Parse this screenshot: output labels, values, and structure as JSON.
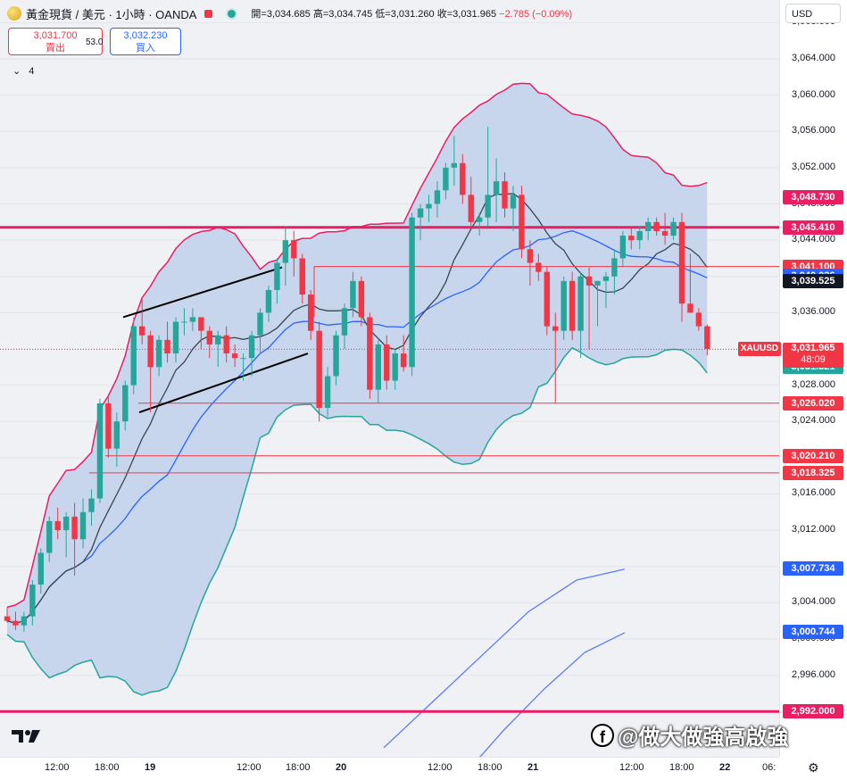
{
  "header": {
    "symbol": "黃金現貨 / 美元 · 1小時 · OANDA",
    "open_label": "開=3,034.685",
    "high_label": "高=3,034.745",
    "low_label": "低=3,031.260",
    "close_label": "收=3,031.965",
    "change": "−2.785 (−0.09%)"
  },
  "trade": {
    "sell_price": "3,031.700",
    "sell_label": "賣出",
    "spread": "53.0",
    "buy_price": "3,032.230",
    "buy_label": "買入"
  },
  "indicators_count": "4",
  "currency": "USD",
  "colors": {
    "up": "#26a69a",
    "down": "#f23645",
    "level": "#e91e63",
    "band_fill": "#c3d3ec",
    "band_upper": "#e91e63",
    "band_lower": "#26a69a",
    "ma_blue": "#2962ff",
    "ma_dark": "#37474f"
  },
  "price_axis": {
    "ticks": [
      "3,068.000",
      "3,064.000",
      "3,060.000",
      "3,056.000",
      "3,052.000",
      "3,048.000",
      "3,044.000",
      "3,040.000",
      "3,036.000",
      "3,032.000",
      "3,028.000",
      "3,024.000",
      "3,020.000",
      "3,016.000",
      "3,012.000",
      "3,008.000",
      "3,004.000",
      "3,000.000",
      "2,996.000",
      "2,992.000"
    ],
    "labels": [
      {
        "text": "3,048.730",
        "color": "#e91e63",
        "price": 3048.73
      },
      {
        "text": "3,045.410",
        "color": "#e91e63",
        "price": 3045.41
      },
      {
        "text": "3,041.100",
        "color": "#f23645",
        "price": 3041.1
      },
      {
        "text": "3,040.026",
        "color": "#2962ff",
        "price": 3040.026
      },
      {
        "text": "3,039.525",
        "color": "#131722",
        "price": 3039.525
      },
      {
        "text": "3,031.321",
        "color": "#26a69a",
        "price": 3030.0
      },
      {
        "text": "3,026.020",
        "color": "#f23645",
        "price": 3026.02
      },
      {
        "text": "3,020.210",
        "color": "#f23645",
        "price": 3020.21
      },
      {
        "text": "3,018.325",
        "color": "#f23645",
        "price": 3018.325
      },
      {
        "text": "3,007.734",
        "color": "#2962ff",
        "price": 3007.734
      },
      {
        "text": "3,000.744",
        "color": "#2962ff",
        "price": 3000.744
      },
      {
        "text": "2,992.000",
        "color": "#e91e63",
        "price": 2992.0
      }
    ],
    "current": {
      "symbol": "XAUUSD",
      "price_text": "3,031.965",
      "countdown": "48:09",
      "price": 3031.965
    }
  },
  "time_axis": [
    "12:00",
    "18:00",
    "19",
    "12:00",
    "18:00",
    "20",
    "12:00",
    "18:00",
    "21",
    "12:00",
    "18:00",
    "22",
    "06:"
  ],
  "watermark": "@做大做強高啟強",
  "chart_data": {
    "type": "candlestick",
    "ylim": [
      2987,
      3070.5
    ],
    "candles": [
      [
        3002.5,
        3003.5,
        3001.8,
        3002.0
      ],
      [
        3002.0,
        3003.0,
        3001.0,
        3001.5
      ],
      [
        3001.5,
        3003.0,
        3000.8,
        3002.5
      ],
      [
        3002.5,
        3006.5,
        3001.5,
        3006.0
      ],
      [
        3006.0,
        3010.0,
        3005.0,
        3009.5
      ],
      [
        3009.5,
        3013.5,
        3008.5,
        3013.0
      ],
      [
        3013.0,
        3014.5,
        3011.0,
        3012.0
      ],
      [
        3012.0,
        3014.0,
        3009.0,
        3013.5
      ],
      [
        3013.5,
        3015.0,
        3007.0,
        3011.0
      ],
      [
        3011.0,
        3015.5,
        3010.0,
        3014.0
      ],
      [
        3014.0,
        3016.5,
        3012.5,
        3015.5
      ],
      [
        3015.5,
        3026.5,
        3015.0,
        3026.0
      ],
      [
        3026.0,
        3027.0,
        3020.0,
        3021.0
      ],
      [
        3021.0,
        3025.0,
        3019.0,
        3024.0
      ],
      [
        3024.0,
        3028.5,
        3023.0,
        3028.0
      ],
      [
        3028.0,
        3035.5,
        3027.0,
        3034.5
      ],
      [
        3034.5,
        3037.5,
        3032.5,
        3033.5
      ],
      [
        3033.5,
        3034.0,
        3025.0,
        3030.0
      ],
      [
        3030.0,
        3033.5,
        3029.0,
        3033.0
      ],
      [
        3033.0,
        3035.0,
        3030.5,
        3031.5
      ],
      [
        3031.5,
        3035.5,
        3030.5,
        3035.0
      ],
      [
        3035.0,
        3036.5,
        3033.5,
        3035.0
      ],
      [
        3035.0,
        3036.5,
        3034.0,
        3035.5
      ],
      [
        3035.5,
        3035.5,
        3032.0,
        3034.0
      ],
      [
        3034.0,
        3034.5,
        3031.0,
        3032.5
      ],
      [
        3032.5,
        3034.0,
        3030.0,
        3033.5
      ],
      [
        3033.5,
        3034.5,
        3030.5,
        3031.5
      ],
      [
        3031.5,
        3032.5,
        3030.0,
        3031.0
      ],
      [
        3031.0,
        3031.5,
        3028.5,
        3031.0
      ],
      [
        3031.0,
        3034.0,
        3029.0,
        3033.5
      ],
      [
        3033.5,
        3036.5,
        3031.5,
        3036.0
      ],
      [
        3036.0,
        3039.0,
        3035.0,
        3038.5
      ],
      [
        3038.5,
        3042.0,
        3037.0,
        3041.5
      ],
      [
        3041.5,
        3045.5,
        3039.0,
        3044.0
      ],
      [
        3044.0,
        3045.0,
        3040.0,
        3042.0
      ],
      [
        3042.0,
        3042.5,
        3037.0,
        3038.0
      ],
      [
        3038.0,
        3038.5,
        3033.0,
        3034.0
      ],
      [
        3034.0,
        3035.0,
        3024.0,
        3025.5
      ],
      [
        3025.5,
        3030.0,
        3024.5,
        3029.0
      ],
      [
        3029.0,
        3034.0,
        3028.0,
        3033.5
      ],
      [
        3033.5,
        3037.0,
        3032.0,
        3036.5
      ],
      [
        3036.5,
        3040.5,
        3035.5,
        3039.5
      ],
      [
        3039.5,
        3040.0,
        3034.5,
        3035.5
      ],
      [
        3035.5,
        3036.0,
        3026.5,
        3027.5
      ],
      [
        3027.5,
        3033.0,
        3026.0,
        3032.5
      ],
      [
        3032.5,
        3033.5,
        3027.5,
        3028.5
      ],
      [
        3028.5,
        3032.0,
        3027.5,
        3031.5
      ],
      [
        3031.5,
        3033.5,
        3029.5,
        3030.0
      ],
      [
        3030.0,
        3047.0,
        3029.0,
        3046.5
      ],
      [
        3046.5,
        3048.0,
        3044.0,
        3047.5
      ],
      [
        3047.5,
        3049.0,
        3046.0,
        3048.0
      ],
      [
        3048.0,
        3050.5,
        3046.5,
        3049.5
      ],
      [
        3049.5,
        3052.5,
        3048.5,
        3052.0
      ],
      [
        3052.0,
        3055.5,
        3050.0,
        3052.5
      ],
      [
        3052.5,
        3053.5,
        3048.0,
        3049.0
      ],
      [
        3049.0,
        3051.0,
        3045.5,
        3046.0
      ],
      [
        3046.0,
        3047.0,
        3044.5,
        3046.5
      ],
      [
        3046.5,
        3056.5,
        3045.5,
        3049.0
      ],
      [
        3049.0,
        3053.0,
        3046.0,
        3050.5
      ],
      [
        3050.5,
        3051.5,
        3046.5,
        3047.5
      ],
      [
        3047.5,
        3050.0,
        3045.0,
        3049.0
      ],
      [
        3049.0,
        3050.0,
        3042.0,
        3043.0
      ],
      [
        3043.0,
        3044.0,
        3039.0,
        3041.5
      ],
      [
        3041.5,
        3042.5,
        3039.5,
        3040.5
      ],
      [
        3040.5,
        3041.0,
        3033.5,
        3034.5
      ],
      [
        3034.5,
        3036.0,
        3026.0,
        3034.0
      ],
      [
        3034.0,
        3040.0,
        3033.0,
        3039.5
      ],
      [
        3039.5,
        3040.5,
        3033.0,
        3034.0
      ],
      [
        3034.0,
        3040.5,
        3031.0,
        3040.0
      ],
      [
        3040.0,
        3041.0,
        3032.0,
        3039.0
      ],
      [
        3039.0,
        3039.5,
        3034.5,
        3039.5
      ],
      [
        3039.5,
        3040.5,
        3036.5,
        3040.0
      ],
      [
        3040.0,
        3043.0,
        3038.0,
        3042.0
      ],
      [
        3042.0,
        3045.0,
        3041.0,
        3044.5
      ],
      [
        3044.5,
        3045.5,
        3043.0,
        3044.0
      ],
      [
        3044.0,
        3045.5,
        3043.0,
        3045.0
      ],
      [
        3045.0,
        3046.5,
        3044.0,
        3046.0
      ],
      [
        3046.0,
        3046.5,
        3044.5,
        3045.0
      ],
      [
        3045.0,
        3047.0,
        3043.5,
        3044.5
      ],
      [
        3044.5,
        3046.5,
        3044.0,
        3046.0
      ],
      [
        3046.0,
        3047.0,
        3035.0,
        3037.0
      ],
      [
        3037.0,
        3042.5,
        3036.0,
        3036.0
      ],
      [
        3036.0,
        3036.5,
        3034.0,
        3034.5
      ],
      [
        3034.5,
        3034.7,
        3031.3,
        3032.0
      ]
    ]
  }
}
